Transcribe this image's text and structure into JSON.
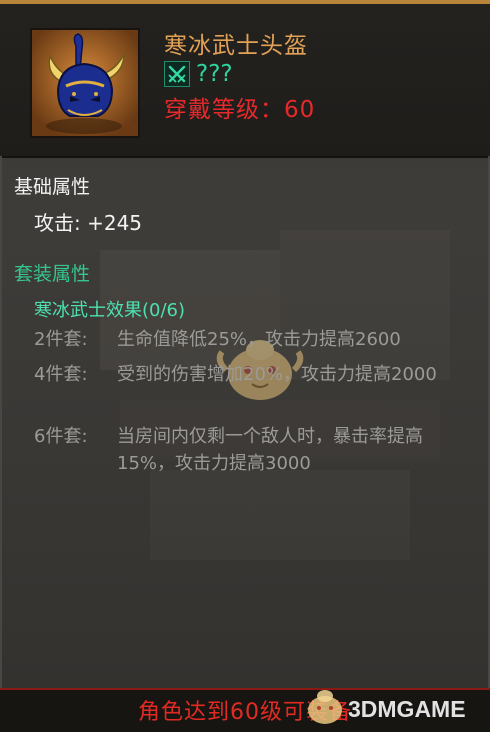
{
  "item": {
    "name": "寒冰武士头盔",
    "set_short_name": "???",
    "required_level": "穿戴等级：60",
    "icon": "horned-helmet-icon"
  },
  "base_attributes": {
    "title": "基础属性",
    "attack": "攻击: +245"
  },
  "set_attributes": {
    "title": "套装属性",
    "effect_title": "寒冰武士效果(0/6)",
    "bonuses": [
      {
        "tag": "2件套:",
        "desc": "生命值降低25%，攻击力提高2600"
      },
      {
        "tag": "4件套:",
        "desc": "受到的伤害增加20%，攻击力提高2000"
      },
      {
        "tag": "6件套:",
        "desc": "当房间内仅剩一个敌人时，暴击率提高15%，攻击力提高3000"
      }
    ]
  },
  "footer": {
    "notice": "角色达到60级可装备"
  },
  "watermark": {
    "text": "3DMGAME"
  },
  "colors": {
    "item_name": "#e3a255",
    "set_name": "#2fd3a0",
    "required_level": "#e6292a",
    "set_title": "#35c58e",
    "bonus_text": "#9b9b98"
  }
}
